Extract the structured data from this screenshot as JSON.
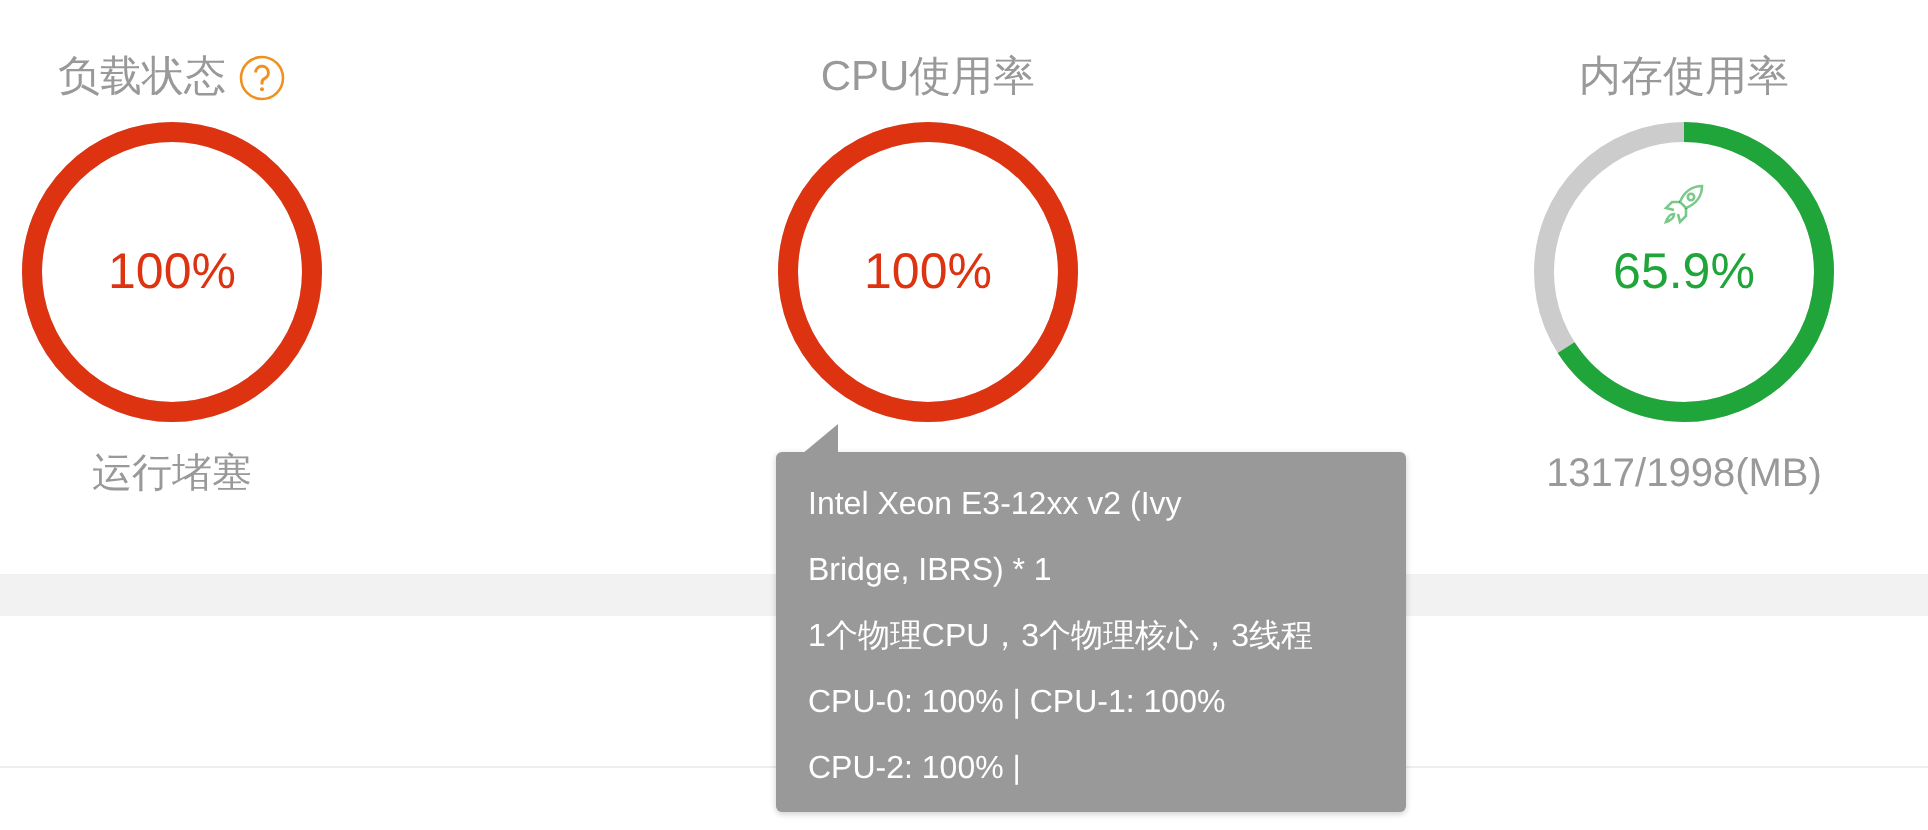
{
  "gauges": [
    {
      "title": "负载状态",
      "help": true,
      "value": "100%",
      "color": "#dd3311",
      "rocket": false,
      "caption": "运行堵塞"
    },
    {
      "title": "CPU使用率",
      "help": false,
      "value": "100%",
      "color": "#dd3311",
      "rocket": false
    },
    {
      "title": "内存使用率",
      "help": false,
      "value": "65.9%",
      "color": "#20a53a",
      "rocket": true,
      "caption": "1317/1998(MB)"
    }
  ],
  "tooltip": {
    "lines": [
      "Intel Xeon E3-12xx v2 (Ivy Bridge, IBRS) * 1",
      "1个物理CPU，3个物理核心，3线程",
      "CPU-0: 100% | CPU-1: 100%",
      "CPU-2: 100% |"
    ]
  }
}
